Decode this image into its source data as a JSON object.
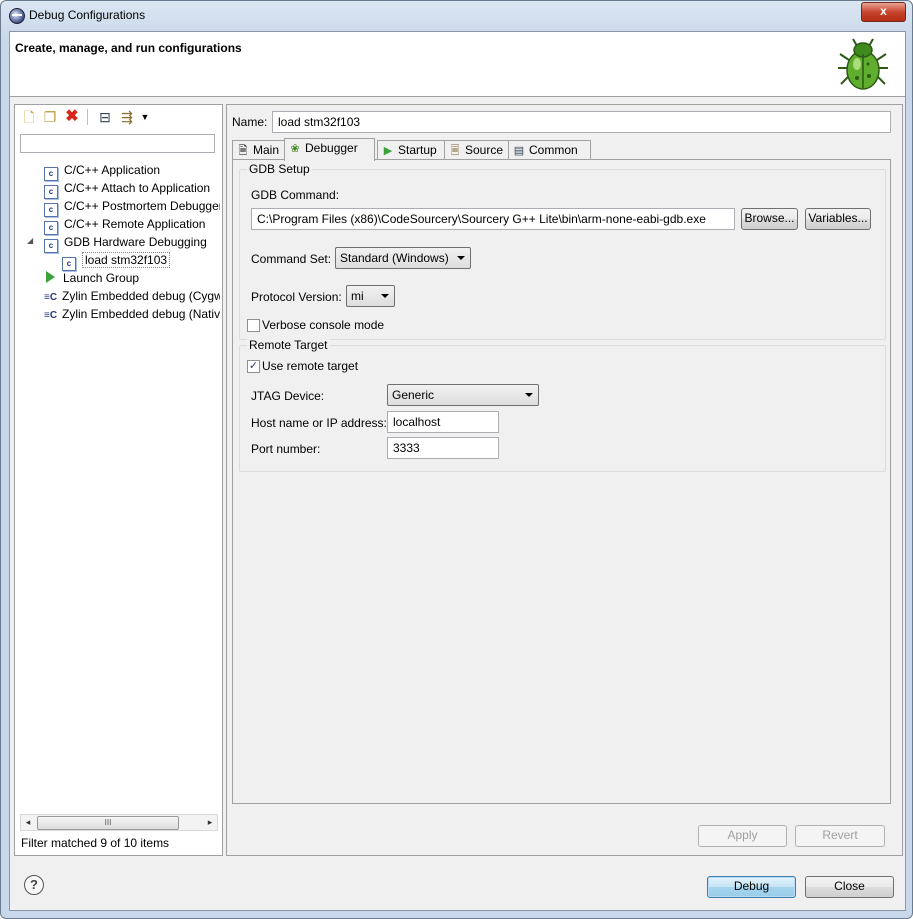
{
  "window": {
    "title": "Debug Configurations",
    "close_glyph": "x"
  },
  "header": {
    "title": "Create, manage, and run configurations",
    "icon": "bug-icon"
  },
  "left": {
    "toolbar": [
      "new-configuration-icon",
      "duplicate-icon",
      "delete-icon",
      "collapse-all-icon",
      "filter-icon",
      "dropdown-icon"
    ],
    "filter_placeholder": "",
    "tree": [
      {
        "label": "C/C++ Application",
        "icon": "c-config-icon",
        "level": 0
      },
      {
        "label": "C/C++ Attach to Application",
        "icon": "c-config-icon",
        "level": 0
      },
      {
        "label": "C/C++ Postmortem Debugger",
        "icon": "c-config-icon",
        "level": 0
      },
      {
        "label": "C/C++ Remote Application",
        "icon": "c-config-icon",
        "level": 0
      },
      {
        "label": "GDB Hardware Debugging",
        "icon": "c-config-icon",
        "level": 0,
        "expanded": true
      },
      {
        "label": "load stm32f103",
        "icon": "c-config-icon",
        "level": 1,
        "selected": true
      },
      {
        "label": "Launch Group",
        "icon": "launch-group-icon",
        "level": 0
      },
      {
        "label": "Zylin Embedded debug (Cygwin)",
        "icon": "zylin-icon",
        "level": 0
      },
      {
        "label": "Zylin Embedded debug (Native)",
        "icon": "zylin-icon",
        "level": 0
      }
    ],
    "status": "Filter matched 9 of 10 items",
    "scroll_thumb": "III"
  },
  "right": {
    "name_label": "Name:",
    "name_value": "load stm32f103",
    "tabs": [
      {
        "label": "Main",
        "icon": "main-tab-icon"
      },
      {
        "label": "Debugger",
        "icon": "debugger-tab-icon",
        "active": true
      },
      {
        "label": "Startup",
        "icon": "startup-tab-icon"
      },
      {
        "label": "Source",
        "icon": "source-tab-icon"
      },
      {
        "label": "Common",
        "icon": "common-tab-icon"
      }
    ],
    "gdb_setup": {
      "title": "GDB Setup",
      "command_label": "GDB Command:",
      "command_value": "C:\\Program Files (x86)\\CodeSourcery\\Sourcery G++ Lite\\bin\\arm-none-eabi-gdb.exe",
      "browse": "Browse...",
      "variables": "Variables...",
      "command_set_label": "Command Set:",
      "command_set_value": "Standard (Windows)",
      "protocol_label": "Protocol Version:",
      "protocol_value": "mi",
      "verbose_label": "Verbose console mode",
      "verbose_checked": false
    },
    "remote": {
      "title": "Remote Target",
      "use_remote_label": "Use remote target",
      "use_remote_checked": true,
      "jtag_label": "JTAG Device:",
      "jtag_value": "Generic",
      "host_label": "Host name or IP address:",
      "host_value": "localhost",
      "port_label": "Port number:",
      "port_value": "3333"
    },
    "apply": "Apply",
    "revert": "Revert"
  },
  "footer": {
    "help": "?",
    "debug": "Debug",
    "close": "Close"
  }
}
